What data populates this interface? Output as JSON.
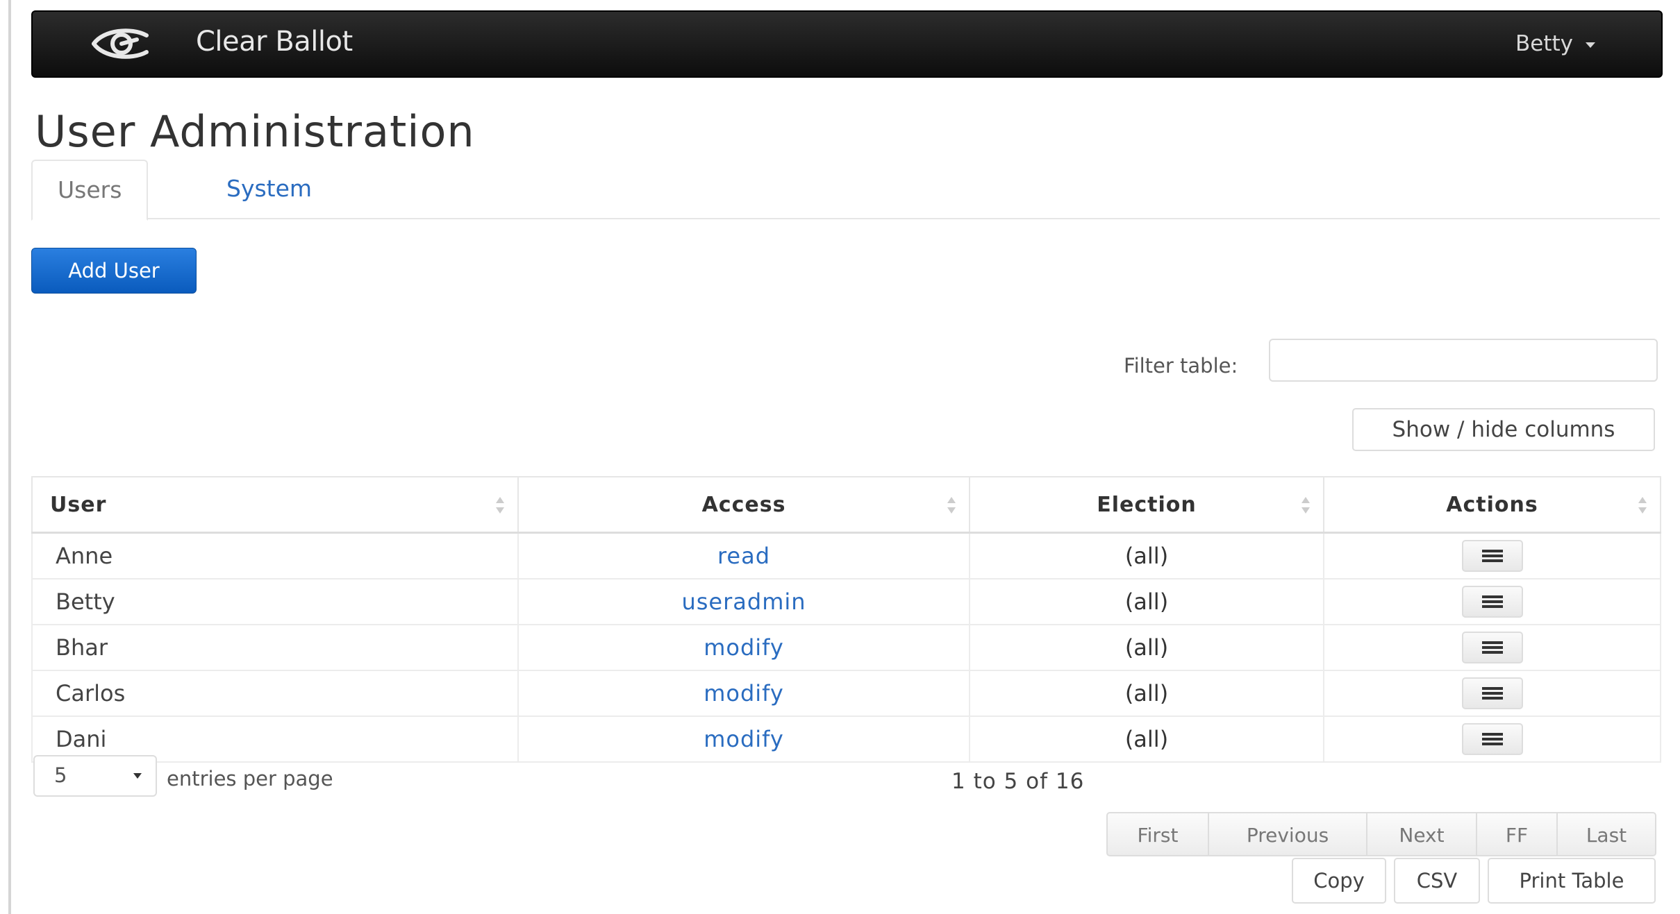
{
  "navbar": {
    "brand": "Clear Ballot",
    "user": "Betty"
  },
  "page": {
    "title": "User Administration"
  },
  "tabs": [
    {
      "label": "Users",
      "active": true
    },
    {
      "label": "System",
      "active": false
    }
  ],
  "toolbar": {
    "add_user_label": "Add User"
  },
  "filter": {
    "label": "Filter table:",
    "value": ""
  },
  "show_hide_label": "Show / hide columns",
  "table": {
    "columns": [
      "User",
      "Access",
      "Election",
      "Actions"
    ],
    "rows": [
      {
        "user": "Anne",
        "access": "read",
        "election": "(all)"
      },
      {
        "user": "Betty",
        "access": "useradmin",
        "election": "(all)"
      },
      {
        "user": "Bhar",
        "access": "modify",
        "election": "(all)"
      },
      {
        "user": "Carlos",
        "access": "modify",
        "election": "(all)"
      },
      {
        "user": "Dani",
        "access": "modify",
        "election": "(all)"
      }
    ]
  },
  "pagination": {
    "per_page": "5",
    "per_page_label": "entries per page",
    "info": "1 to 5 of 16",
    "buttons": [
      "First",
      "Previous",
      "Next",
      "FF",
      "Last"
    ]
  },
  "export": {
    "copy": "Copy",
    "csv": "CSV",
    "print": "Print Table"
  },
  "colors": {
    "navbar": "#111111",
    "primary": "#0a5bbd",
    "link": "#2a6cc0"
  }
}
